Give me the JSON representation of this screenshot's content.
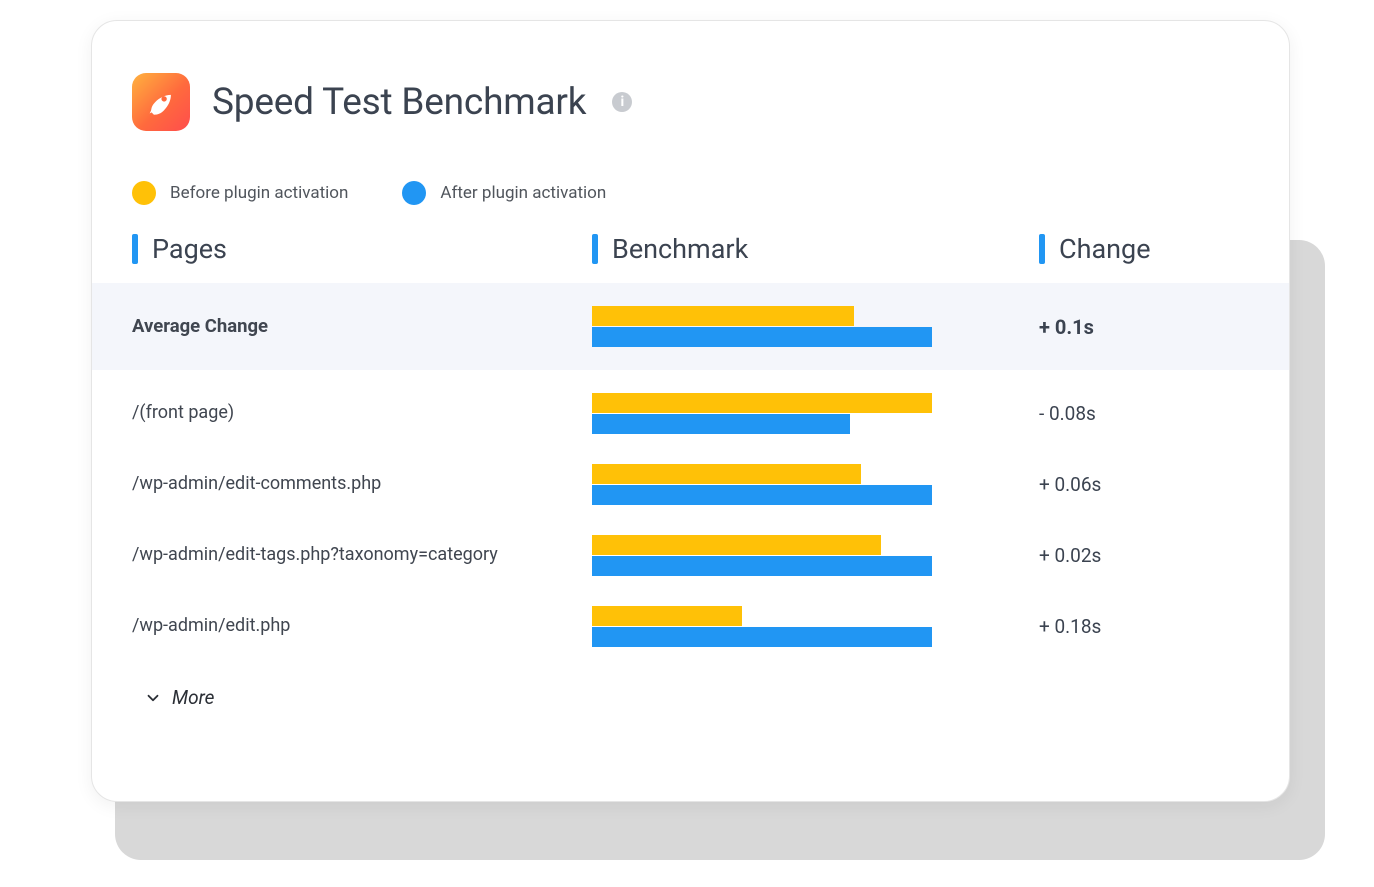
{
  "header": {
    "title": "Speed Test Benchmark",
    "info_symbol": "i"
  },
  "legend": {
    "before_label": "Before plugin activation",
    "after_label": "After plugin activation"
  },
  "columns": {
    "pages": "Pages",
    "benchmark": "Benchmark",
    "change": "Change"
  },
  "rows": {
    "summary": {
      "label": "Average Change",
      "before_pct": 77,
      "after_pct": 100,
      "change": "+ 0.1s"
    },
    "list": [
      {
        "label": "/(front page)",
        "before_pct": 100,
        "after_pct": 76,
        "change": "- 0.08s"
      },
      {
        "label": "/wp-admin/edit-comments.php",
        "before_pct": 79,
        "after_pct": 100,
        "change": "+ 0.06s"
      },
      {
        "label": "/wp-admin/edit-tags.php?taxonomy=category",
        "before_pct": 85,
        "after_pct": 100,
        "change": "+ 0.02s"
      },
      {
        "label": "/wp-admin/edit.php",
        "before_pct": 44,
        "after_pct": 100,
        "change": "+ 0.18s"
      }
    ]
  },
  "more_label": "More",
  "colors": {
    "before": "#ffc107",
    "after": "#2196f3",
    "accent": "#2196f3"
  },
  "chart_data": {
    "type": "bar",
    "title": "Speed Test Benchmark",
    "orientation": "horizontal",
    "x_unit": "% of max in row pair",
    "series_names": [
      "Before plugin activation",
      "After plugin activation"
    ],
    "categories": [
      "Average Change",
      "/(front page)",
      "/wp-admin/edit-comments.php",
      "/wp-admin/edit-tags.php?taxonomy=category",
      "/wp-admin/edit.php"
    ],
    "series": [
      {
        "name": "Before plugin activation",
        "values": [
          77,
          100,
          79,
          85,
          44
        ]
      },
      {
        "name": "After plugin activation",
        "values": [
          100,
          76,
          100,
          100,
          100
        ]
      }
    ],
    "change_seconds": [
      0.1,
      -0.08,
      0.06,
      0.02,
      0.18
    ],
    "note": "Bar values are relative lengths read from the image (percent of the longer bar in each pair); absolute seconds are not shown, only the delta in the Change column."
  }
}
